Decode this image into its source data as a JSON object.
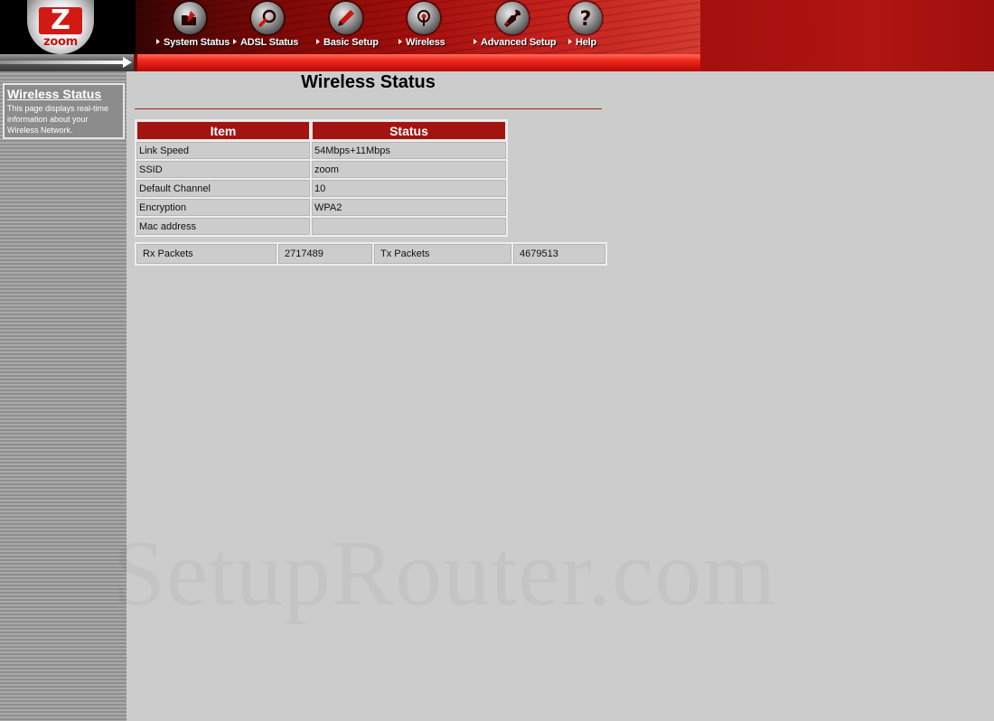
{
  "brand": {
    "logo_letter": "Z",
    "logo_word": "zoom"
  },
  "nav": {
    "items": [
      {
        "label": "System Status",
        "icon": "folder-pencil-icon"
      },
      {
        "label": "ADSL Status",
        "icon": "magnifier-icon"
      },
      {
        "label": "Basic Setup",
        "icon": "pencil-icon"
      },
      {
        "label": "Wireless",
        "icon": "wireless-icon"
      },
      {
        "label": "Advanced Setup",
        "icon": "wrench-icon"
      },
      {
        "label": "Help",
        "icon": "question-icon"
      }
    ]
  },
  "sidebar": {
    "title": "Wireless Status",
    "description": "This page displays real-time information about your Wireless Network."
  },
  "page": {
    "title": "Wireless Status",
    "table": {
      "headers": [
        "Item",
        "Status"
      ],
      "rows": [
        [
          "Link Speed",
          "54Mbps+11Mbps"
        ],
        [
          "SSID",
          "zoom"
        ],
        [
          "Default Channel",
          "10"
        ],
        [
          "Encryption",
          "WPA2"
        ],
        [
          "Mac address",
          ""
        ]
      ]
    },
    "packets": {
      "rx_label": "Rx Packets",
      "rx_value": "2717489",
      "tx_label": "Tx Packets",
      "tx_value": "4679513"
    }
  },
  "watermark": "SetupRouter.com",
  "colors": {
    "brand_red": "#a31410",
    "background": "#cccccc"
  }
}
